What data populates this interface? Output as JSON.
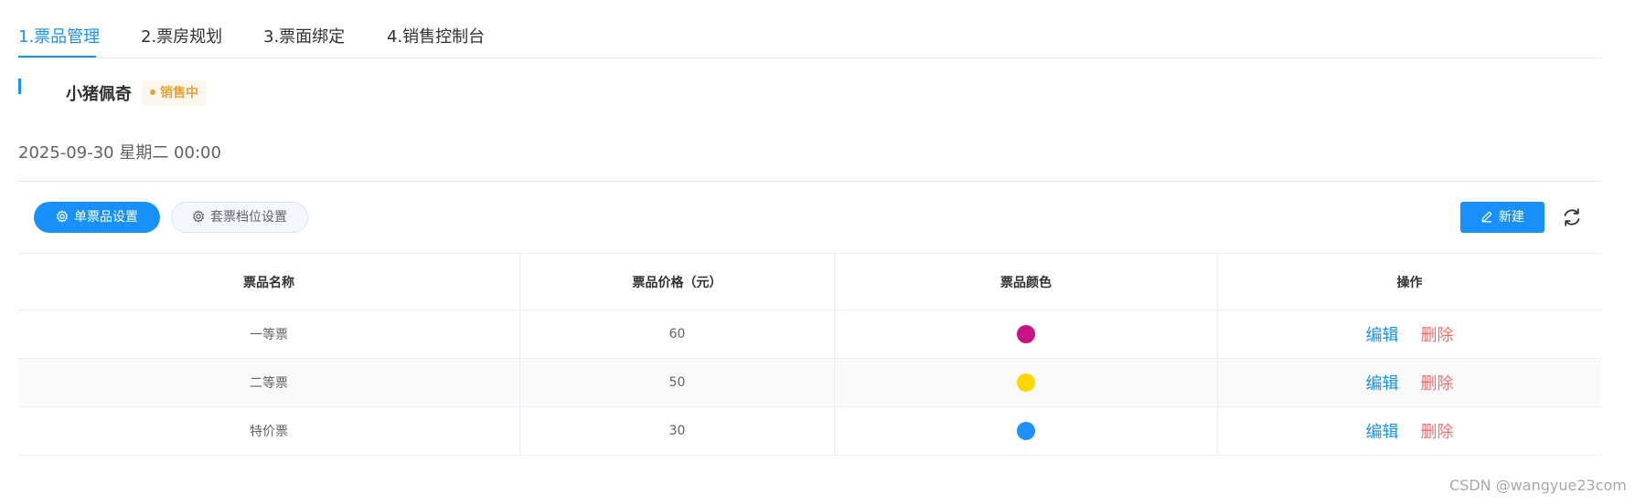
{
  "tabs": [
    {
      "label": "1.票品管理",
      "active": true
    },
    {
      "label": "2.票房规划",
      "active": false
    },
    {
      "label": "3.票面绑定",
      "active": false
    },
    {
      "label": "4.销售控制台",
      "active": false
    }
  ],
  "event": {
    "title": "小猪佩奇",
    "status": "销售中",
    "status_color": "#e6a23c",
    "date": "2025-09-30 星期二 00:00"
  },
  "toolbar": {
    "single_ticket_label": "单票品设置",
    "package_ticket_label": "套票档位设置",
    "new_label": "新建",
    "settings_icon": "gear-icon",
    "new_icon": "pencil-icon",
    "refresh_icon": "refresh-icon",
    "accent_color": "#1890ff"
  },
  "table": {
    "columns": [
      "票品名称",
      "票品价格（元）",
      "票品颜色",
      "操作"
    ],
    "rows": [
      {
        "name": "一等票",
        "price": "60",
        "color": "#c71585",
        "edit": "编辑",
        "delete": "删除"
      },
      {
        "name": "二等票",
        "price": "50",
        "color": "#ffd700",
        "edit": "编辑",
        "delete": "删除"
      },
      {
        "name": "特价票",
        "price": "30",
        "color": "#1e90ff",
        "edit": "编辑",
        "delete": "删除"
      }
    ]
  },
  "watermark": "CSDN @wangyue23com"
}
